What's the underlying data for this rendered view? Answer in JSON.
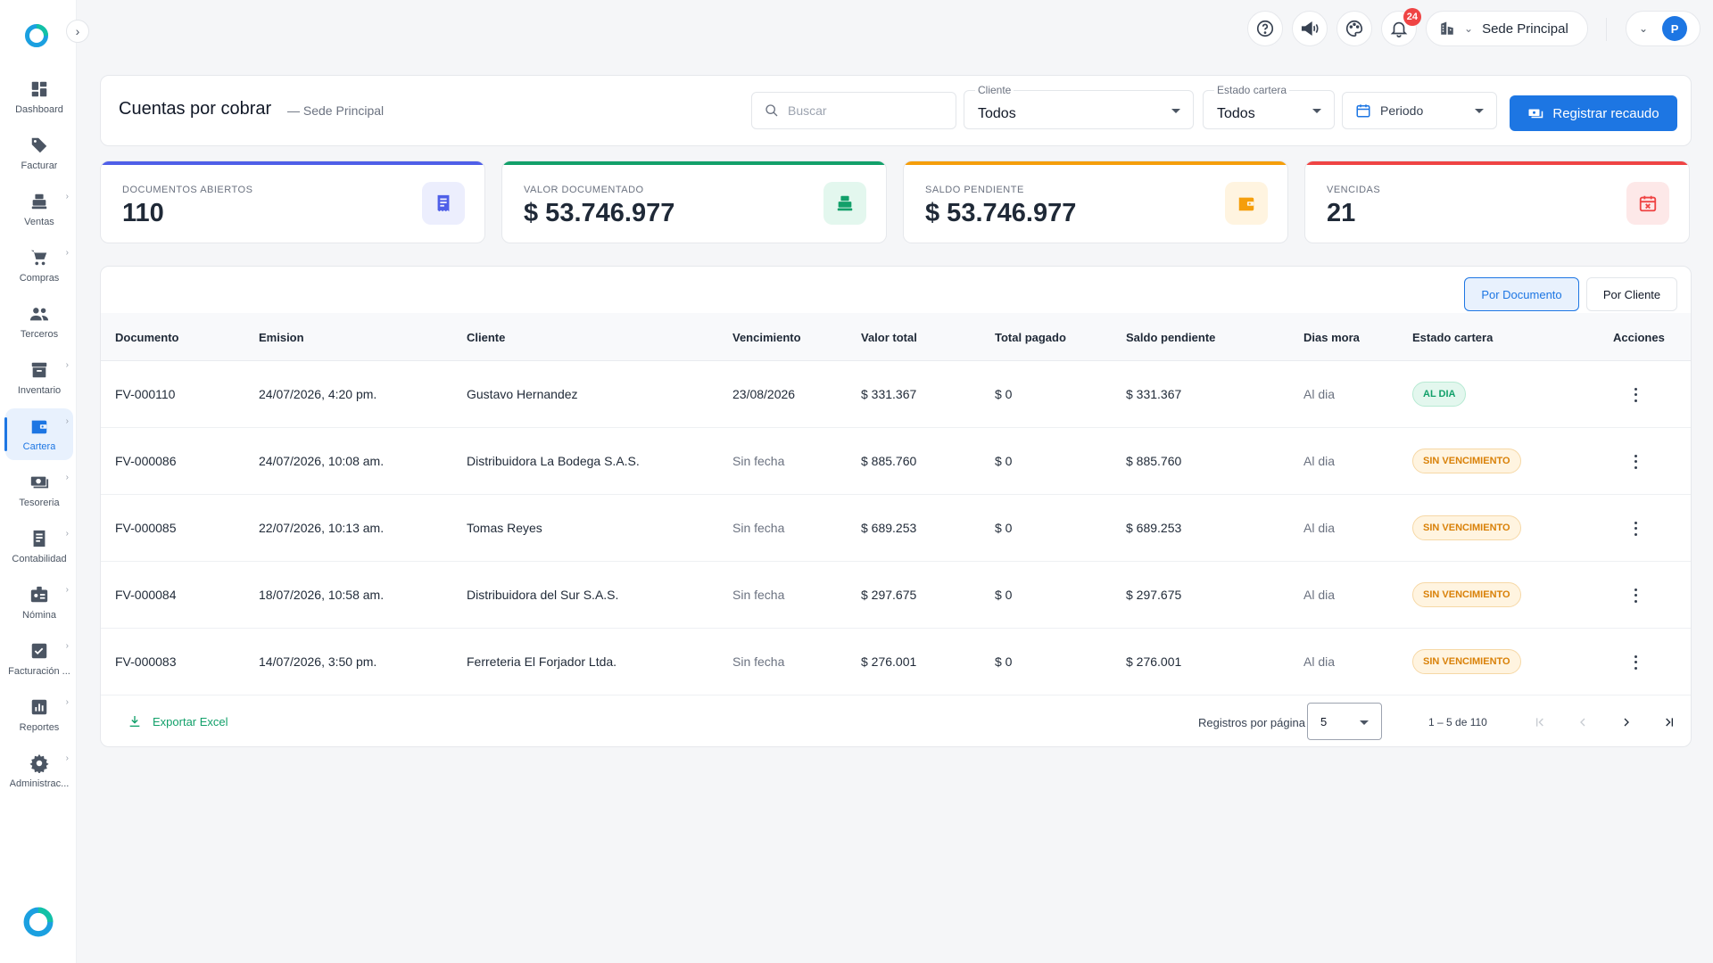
{
  "sidebar": {
    "items": [
      {
        "label": "Dashboard",
        "icon": "dashboard-icon",
        "chevron": false,
        "active": false
      },
      {
        "label": "Facturar",
        "icon": "tag-icon",
        "chevron": false,
        "active": false
      },
      {
        "label": "Ventas",
        "icon": "cash-register-icon",
        "chevron": true,
        "active": false
      },
      {
        "label": "Compras",
        "icon": "cart-icon",
        "chevron": true,
        "active": false
      },
      {
        "label": "Terceros",
        "icon": "people-icon",
        "chevron": false,
        "active": false
      },
      {
        "label": "Inventario",
        "icon": "archive-icon",
        "chevron": true,
        "active": false
      },
      {
        "label": "Cartera",
        "icon": "wallet-icon",
        "chevron": true,
        "active": true
      },
      {
        "label": "Tesoreria",
        "icon": "money-icon",
        "chevron": true,
        "active": false
      },
      {
        "label": "Contabilidad",
        "icon": "ledger-icon",
        "chevron": true,
        "active": false
      },
      {
        "label": "Nómina",
        "icon": "badge-icon",
        "chevron": true,
        "active": false
      },
      {
        "label": "Facturación ...",
        "icon": "invoice-icon",
        "chevron": true,
        "active": false
      },
      {
        "label": "Reportes",
        "icon": "chart-icon",
        "chevron": true,
        "active": false
      },
      {
        "label": "Administrac...",
        "icon": "gear-icon",
        "chevron": true,
        "active": false
      }
    ]
  },
  "topbar": {
    "notifications_count": "24",
    "sede": "Sede Principal",
    "user_initial": "P"
  },
  "header": {
    "title": "Cuentas por cobrar",
    "subtitle": "— Sede Principal",
    "search_placeholder": "Buscar",
    "filters": {
      "cliente_label": "Cliente",
      "cliente_value": "Todos",
      "estado_label": "Estado cartera",
      "estado_value": "Todos",
      "periodo": "Periodo"
    },
    "primary_button": "Registrar recaudo"
  },
  "stats": [
    {
      "label": "Documentos abiertos",
      "value": "110",
      "color": "#4f5fe8",
      "bg": "#eceefd",
      "icon": "document-icon"
    },
    {
      "label": "Valor documentado",
      "value": "$ 53.746.977",
      "color": "#12a06a",
      "bg": "#e3f7ee",
      "icon": "cash-register-icon"
    },
    {
      "label": "Saldo pendiente",
      "value": "$ 53.746.977",
      "color": "#f59e0b",
      "bg": "#fff4e0",
      "icon": "wallet-icon"
    },
    {
      "label": "Vencidas",
      "value": "21",
      "color": "#ef4444",
      "bg": "#fde8e8",
      "icon": "calendar-x-icon"
    }
  ],
  "table": {
    "view_toggle": {
      "by_document": "Por Documento",
      "by_client": "Por Cliente"
    },
    "columns": [
      "Documento",
      "Emision",
      "Cliente",
      "Vencimiento",
      "Valor total",
      "Total pagado",
      "Saldo pendiente",
      "Dias mora",
      "Estado cartera",
      "Acciones"
    ],
    "rows": [
      {
        "documento": "FV-000110",
        "emision": "24/07/2026, 4:20 pm.",
        "cliente": "Gustavo Hernandez",
        "vencimiento": "23/08/2026",
        "valor_total": "$ 331.367",
        "total_pagado": "$ 0",
        "saldo": "$ 331.367",
        "mora": "Al dia",
        "estado": "AL DIA",
        "estado_kind": "ok"
      },
      {
        "documento": "FV-000086",
        "emision": "24/07/2026, 10:08 am.",
        "cliente": "Distribuidora La Bodega S.A.S.",
        "vencimiento": "Sin fecha",
        "valor_total": "$ 885.760",
        "total_pagado": "$ 0",
        "saldo": "$ 885.760",
        "mora": "Al dia",
        "estado": "SIN VENCIMIENTO",
        "estado_kind": "warn"
      },
      {
        "documento": "FV-000085",
        "emision": "22/07/2026, 10:13 am.",
        "cliente": "Tomas Reyes",
        "vencimiento": "Sin fecha",
        "valor_total": "$ 689.253",
        "total_pagado": "$ 0",
        "saldo": "$ 689.253",
        "mora": "Al dia",
        "estado": "SIN VENCIMIENTO",
        "estado_kind": "warn"
      },
      {
        "documento": "FV-000084",
        "emision": "18/07/2026, 10:58 am.",
        "cliente": "Distribuidora del Sur S.A.S.",
        "vencimiento": "Sin fecha",
        "valor_total": "$ 297.675",
        "total_pagado": "$ 0",
        "saldo": "$ 297.675",
        "mora": "Al dia",
        "estado": "SIN VENCIMIENTO",
        "estado_kind": "warn"
      },
      {
        "documento": "FV-000083",
        "emision": "14/07/2026, 3:50 pm.",
        "cliente": "Ferreteria El Forjador Ltda.",
        "vencimiento": "Sin fecha",
        "valor_total": "$ 276.001",
        "total_pagado": "$ 0",
        "saldo": "$ 276.001",
        "mora": "Al dia",
        "estado": "SIN VENCIMIENTO",
        "estado_kind": "warn"
      }
    ],
    "footer": {
      "export": "Exportar Excel",
      "rows_per_page_label": "Registros por página",
      "rows_per_page": "5",
      "range": "1 – 5 de 110"
    }
  }
}
